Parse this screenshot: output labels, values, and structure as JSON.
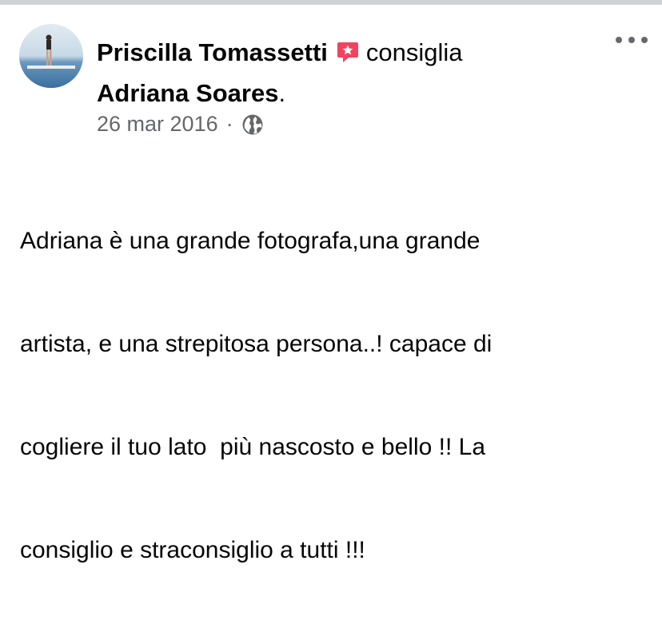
{
  "post": {
    "author": "Priscilla Tomassetti",
    "verb": "consiglia",
    "subject": "Adriana Soares",
    "subject_suffix": ".",
    "date": "26 mar 2016",
    "separator": "·",
    "privacy_icon": "globe-icon",
    "recommendation_icon": "recommendation-star-icon",
    "body_lines": [
      "Adriana è una grande fotografa,una grande",
      "artista, e una strepitosa persona..! capace di",
      "cogliere il tuo lato  più nascosto e bello !! La",
      "consiglio e straconsiglio a tutti !!!"
    ],
    "more_icon": "more-options-icon"
  },
  "colors": {
    "recommend_red": "#f3425f",
    "meta_grey": "#65676b",
    "divider": "#cfd2d6"
  }
}
